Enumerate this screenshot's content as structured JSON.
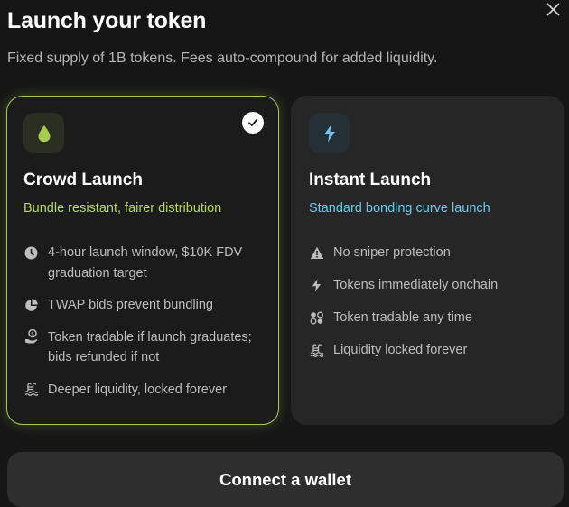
{
  "header": {
    "title": "Launch your token",
    "subtitle": "Fixed supply of 1B tokens. Fees auto-compound for added liquidity.",
    "close_icon": "close-icon"
  },
  "options": [
    {
      "id": "crowd",
      "selected": true,
      "icon": "drop-icon",
      "title": "Crowd Launch",
      "tagline": "Bundle resistant, fairer distribution",
      "accent": "#a5cc4f",
      "features": [
        {
          "icon": "clock-icon",
          "text": "4-hour launch window, $10K FDV graduation target"
        },
        {
          "icon": "pie-chart-icon",
          "text": "TWAP bids prevent bundling"
        },
        {
          "icon": "hand-coin-icon",
          "text": "Token tradable if launch graduates; bids refunded if not"
        },
        {
          "icon": "pool-icon",
          "text": "Deeper liquidity, locked forever"
        }
      ]
    },
    {
      "id": "instant",
      "selected": false,
      "icon": "bolt-icon",
      "title": "Instant Launch",
      "tagline": "Standard bonding curve launch",
      "accent": "#6cc8f2",
      "features": [
        {
          "icon": "warning-icon",
          "text": "No sniper protection"
        },
        {
          "icon": "bolt-icon",
          "text": "Tokens immediately onchain"
        },
        {
          "icon": "tokens-icon",
          "text": "Token tradable any time"
        },
        {
          "icon": "pool-icon",
          "text": "Liquidity locked forever"
        }
      ]
    }
  ],
  "footer": {
    "connect_label": "Connect a wallet"
  }
}
